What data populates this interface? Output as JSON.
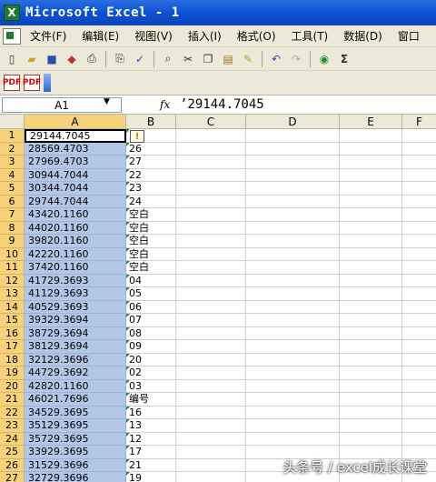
{
  "window": {
    "title": "Microsoft Excel - 1",
    "app_icon": "excel-icon"
  },
  "menu": [
    "文件(F)",
    "编辑(E)",
    "视图(V)",
    "插入(I)",
    "格式(O)",
    "工具(T)",
    "数据(D)",
    "窗口"
  ],
  "toolbar": {
    "standard_icons": [
      "new-icon",
      "open-icon",
      "save-icon",
      "permission-icon",
      "print-icon",
      "print-preview-icon",
      "spelling-icon",
      "research-icon",
      "cut-icon",
      "copy-icon",
      "paste-icon",
      "format-painter-icon",
      "undo-icon",
      "redo-icon",
      "hyperlink-icon",
      "autosum-icon"
    ],
    "autosum_label": "Σ",
    "pdf_icons": [
      "pdf-convert-icon",
      "pdf-convert-options-icon"
    ]
  },
  "formula_bar": {
    "name_box": "A1",
    "fx_label": "fx",
    "formula": "’29144.7045"
  },
  "columns": [
    "A",
    "B",
    "C",
    "D",
    "E",
    "F"
  ],
  "rows": [
    {
      "n": "1",
      "a": "29144.7045",
      "b": ""
    },
    {
      "n": "2",
      "a": "28569.4703",
      "b": "26"
    },
    {
      "n": "3",
      "a": "27969.4703",
      "b": "27"
    },
    {
      "n": "4",
      "a": "30944.7044",
      "b": "22"
    },
    {
      "n": "5",
      "a": "30344.7044",
      "b": "23"
    },
    {
      "n": "6",
      "a": "29744.7044",
      "b": "24"
    },
    {
      "n": "7",
      "a": "43420.1160",
      "b": "空白"
    },
    {
      "n": "8",
      "a": "44020.1160",
      "b": "空白"
    },
    {
      "n": "9",
      "a": "39820.1160",
      "b": "空白"
    },
    {
      "n": "10",
      "a": "42220.1160",
      "b": "空白"
    },
    {
      "n": "11",
      "a": "37420.1160",
      "b": "空白"
    },
    {
      "n": "12",
      "a": "41729.3693",
      "b": "04"
    },
    {
      "n": "13",
      "a": "41129.3693",
      "b": "05"
    },
    {
      "n": "14",
      "a": "40529.3693",
      "b": "06"
    },
    {
      "n": "15",
      "a": "39329.3694",
      "b": "07"
    },
    {
      "n": "16",
      "a": "38729.3694",
      "b": "08"
    },
    {
      "n": "17",
      "a": "38129.3694",
      "b": "09"
    },
    {
      "n": "18",
      "a": "32129.3696",
      "b": "20"
    },
    {
      "n": "19",
      "a": "44729.3692",
      "b": "02"
    },
    {
      "n": "20",
      "a": "42820.1160",
      "b": "03"
    },
    {
      "n": "21",
      "a": "46021.7696",
      "b": "编号"
    },
    {
      "n": "22",
      "a": "34529.3695",
      "b": "16"
    },
    {
      "n": "23",
      "a": "35129.3695",
      "b": "13"
    },
    {
      "n": "24",
      "a": "35729.3695",
      "b": "12"
    },
    {
      "n": "25",
      "a": "33929.3695",
      "b": "17"
    },
    {
      "n": "26",
      "a": "31529.3696",
      "b": "21"
    },
    {
      "n": "27",
      "a": "32729.3696",
      "b": "19"
    }
  ],
  "error_indicator": "!",
  "watermark": "头条号 / excel成长课堂",
  "colors": {
    "title_bar": "#0a4fd1",
    "selection": "#b3c6e6",
    "header_selected": "#f8d27a"
  }
}
